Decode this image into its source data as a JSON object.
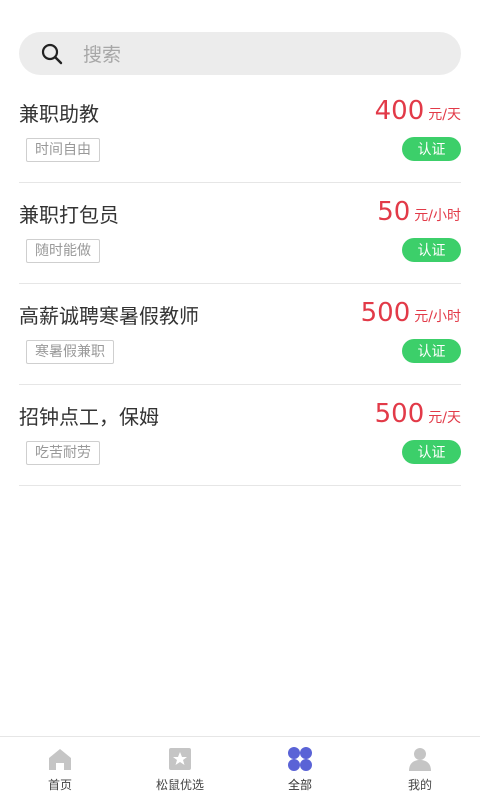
{
  "search": {
    "placeholder": "搜索"
  },
  "jobs": [
    {
      "title": "兼职助教",
      "tag": "时间自由",
      "pay_amount": "400",
      "pay_unit": "元/天",
      "badge": "认证"
    },
    {
      "title": "兼职打包员",
      "tag": "随时能做",
      "pay_amount": "50",
      "pay_unit": "元/小时",
      "badge": "认证"
    },
    {
      "title": "高薪诚聘寒暑假教师",
      "tag": "寒暑假兼职",
      "pay_amount": "500",
      "pay_unit": "元/小时",
      "badge": "认证"
    },
    {
      "title": "招钟点工，保姆",
      "tag": "吃苦耐劳",
      "pay_amount": "500",
      "pay_unit": "元/天",
      "badge": "认证"
    }
  ],
  "tabs": [
    {
      "label": "首页",
      "icon": "home-icon"
    },
    {
      "label": "松鼠优选",
      "icon": "star-card-icon"
    },
    {
      "label": "全部",
      "icon": "grid-icon",
      "active": true
    },
    {
      "label": "我的",
      "icon": "user-icon"
    }
  ],
  "colors": {
    "price": "#e23a48",
    "badge": "#3ccf6a",
    "active_tab": "#5a63d6",
    "inactive_tab": "#c5c5c5"
  }
}
